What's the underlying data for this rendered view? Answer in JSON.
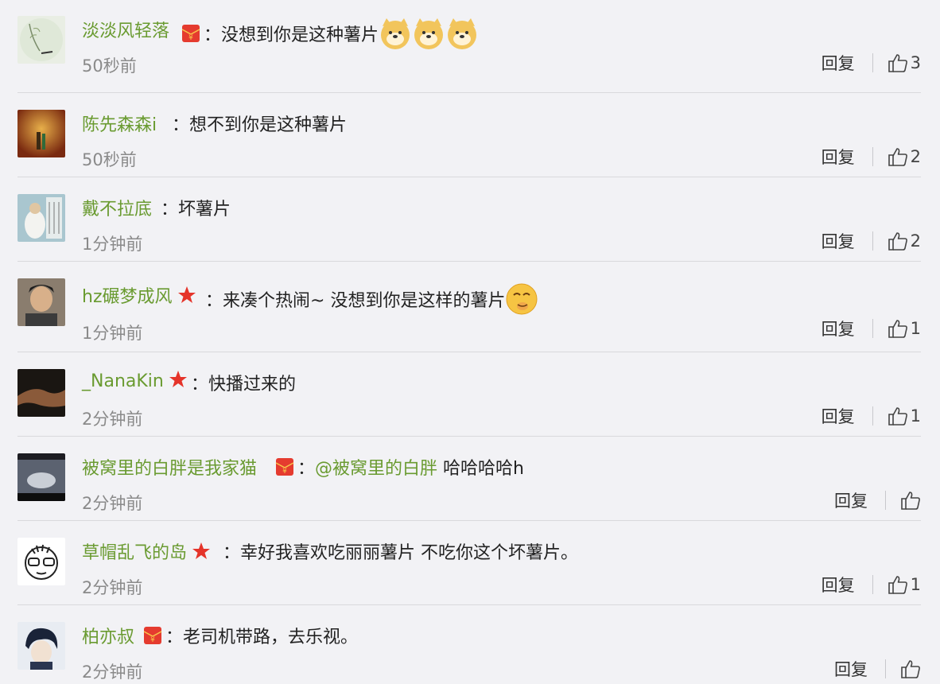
{
  "comments": [
    {
      "name": "淡淡风轻落",
      "badge": "red-envelope-icon",
      "separator": "：",
      "text": "没想到你是这种薯片",
      "time": "50秒前",
      "reply_label": "回复",
      "likes": "3",
      "emoji": "doge-icon"
    },
    {
      "name": "陈先森森i",
      "badge": "",
      "separator": "：",
      "text": "想不到你是这种薯片",
      "time": "50秒前",
      "reply_label": "回复",
      "likes": "2"
    },
    {
      "name": "戴不拉底",
      "badge": "",
      "separator": "：",
      "text": "坏薯片",
      "time": "1分钟前",
      "reply_label": "回复",
      "likes": "2"
    },
    {
      "name": "hz碾梦成风",
      "badge": "star-icon",
      "separator": "：",
      "text": "来凑个热闹~ 没想到你是这样的薯片",
      "time": "1分钟前",
      "reply_label": "回复",
      "likes": "1",
      "emoji": "giggle-icon"
    },
    {
      "name": "_NanaKin",
      "badge": "star-icon",
      "separator": "：",
      "text": "快播过来的",
      "time": "2分钟前",
      "reply_label": "回复",
      "likes": "1"
    },
    {
      "name": "被窝里的白胖是我家猫",
      "badge": "red-envelope-icon",
      "separator": "：",
      "mention": "@被窝里的白胖",
      "text": " 哈哈哈哈h",
      "time": "2分钟前",
      "reply_label": "回复",
      "likes": ""
    },
    {
      "name": "草帽乱飞的岛",
      "badge": "star-icon",
      "separator": "：",
      "text": "幸好我喜欢吃丽丽薯片 不吃你这个坏薯片。",
      "time": "2分钟前",
      "reply_label": "回复",
      "likes": "1"
    },
    {
      "name": "柏亦叔",
      "badge": "red-envelope-icon",
      "separator": "：",
      "text": "老司机带路，去乐视。",
      "time": "2分钟前",
      "reply_label": "回复",
      "likes": ""
    }
  ],
  "colors": {
    "username": "#6a9b31",
    "background": "#f2f2f5",
    "divider": "#d9d9dc"
  }
}
